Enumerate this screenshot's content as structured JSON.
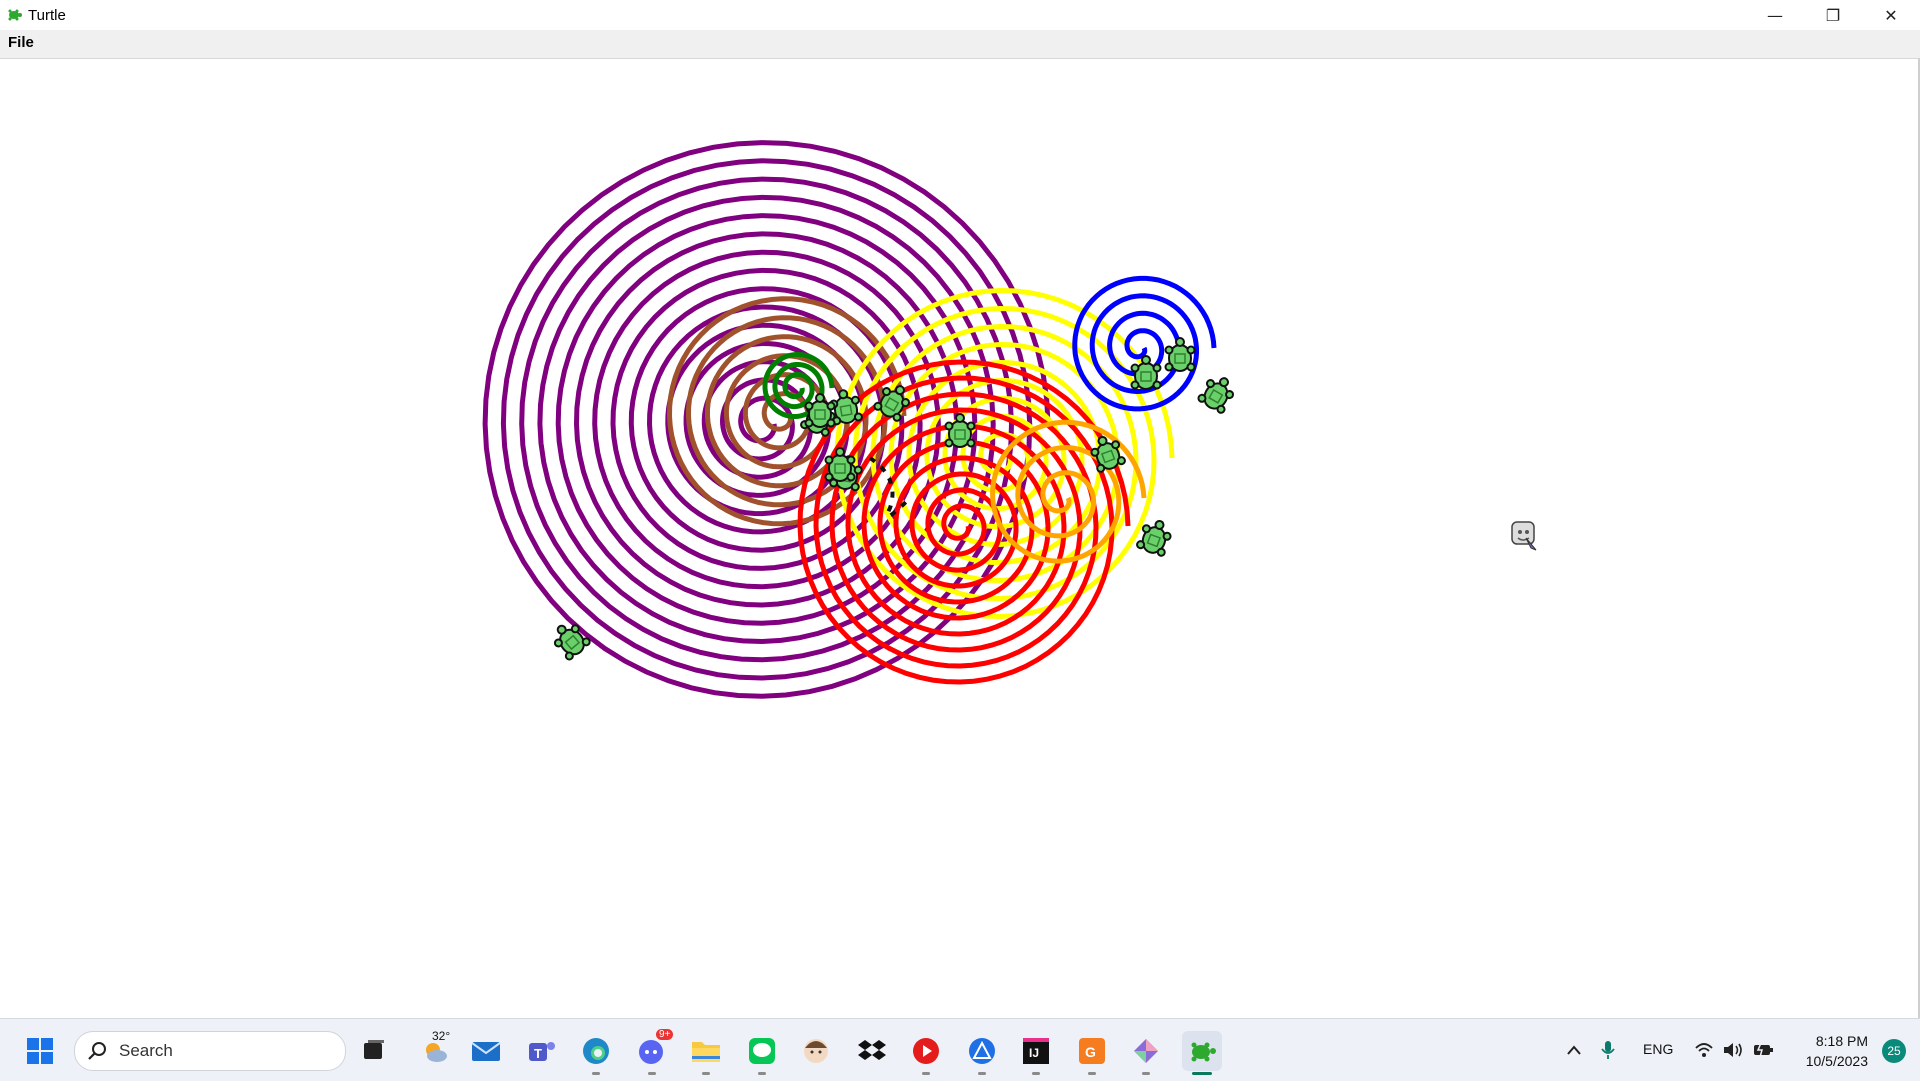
{
  "window": {
    "title": "Turtle",
    "controls": {
      "minimize": "—",
      "restore": "❐",
      "close": "✕"
    }
  },
  "menu": {
    "file": "File"
  },
  "drawing": {
    "spirals": [
      {
        "color": "#800080",
        "turns": 15
      },
      {
        "color": "#a0522d",
        "turns": 6
      },
      {
        "color": "#008000",
        "turns": 3
      },
      {
        "color": "#ffff00",
        "turns": 9
      },
      {
        "color": "#ff0000",
        "turns": 10
      },
      {
        "color": "#ffa500",
        "turns": 3
      },
      {
        "color": "#0000ff",
        "turns": 4
      }
    ],
    "turtle_count": 13,
    "turtle_color": "#6ad06a"
  },
  "taskbar": {
    "search_placeholder": "Search",
    "weather_temp": "32°",
    "chat_badge": "9+",
    "language": "ENG",
    "time": "8:18 PM",
    "date": "10/5/2023",
    "notification_count": "25"
  }
}
